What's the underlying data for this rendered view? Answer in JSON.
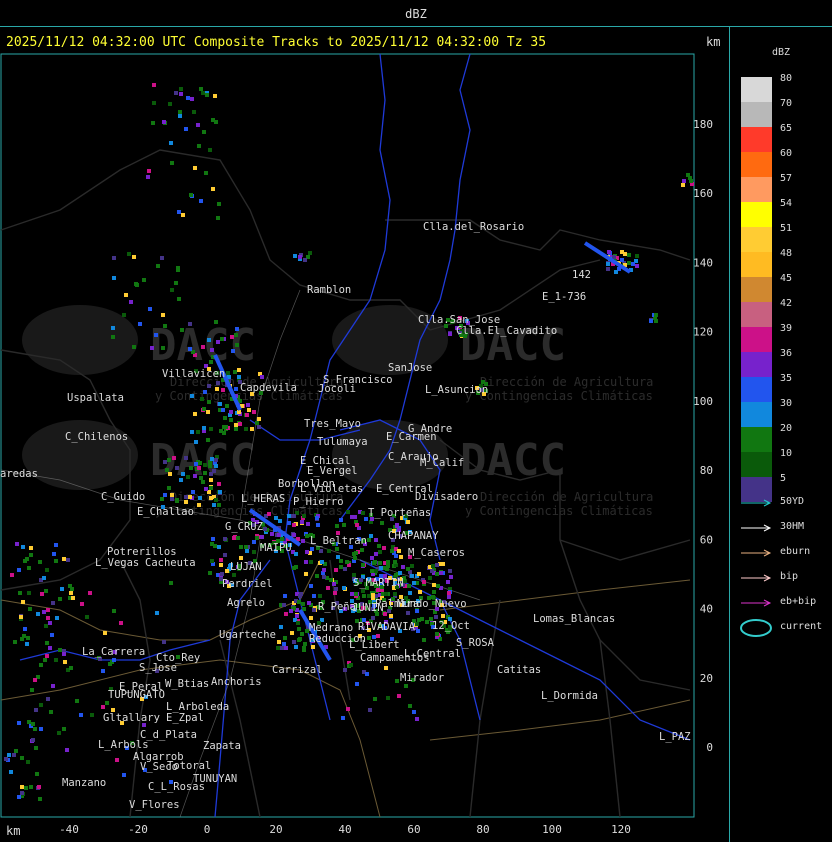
{
  "header": {
    "product": "dBZ"
  },
  "title": "2025/11/12 04:32:00 UTC Composite Tracks to 2025/11/12 04:32:00 Tz 35",
  "km_label": "km",
  "axis": {
    "x_ticks": [
      "-40",
      "-20",
      "0",
      "20",
      "40",
      "60",
      "80",
      "100",
      "120"
    ],
    "y_ticks": [
      "180",
      "160",
      "140",
      "120",
      "100",
      "80",
      "60",
      "40",
      "20",
      "0"
    ]
  },
  "legend": {
    "title": "dBZ",
    "bins": [
      {
        "label": "80",
        "color": "#d8d8d8"
      },
      {
        "label": "70",
        "color": "#b8b8b8"
      },
      {
        "label": "65",
        "color": "#ff3a2a"
      },
      {
        "label": "60",
        "color": "#ff6a10"
      },
      {
        "label": "57",
        "color": "#ff9a60"
      },
      {
        "label": "54",
        "color": "#ffff00"
      },
      {
        "label": "51",
        "color": "#ffcc33"
      },
      {
        "label": "48",
        "color": "#ffbb22"
      },
      {
        "label": "45",
        "color": "#d08830"
      },
      {
        "label": "42",
        "color": "#c86080"
      },
      {
        "label": "39",
        "color": "#cc1188"
      },
      {
        "label": "36",
        "color": "#7722cc"
      },
      {
        "label": "35",
        "color": "#2255ee"
      },
      {
        "label": "30",
        "color": "#1188dd"
      },
      {
        "label": "20",
        "color": "#117711"
      },
      {
        "label": "10",
        "color": "#0a5a0a"
      },
      {
        "label": "5",
        "color": "#443388"
      }
    ],
    "tracks": [
      {
        "label": "50YD",
        "color": "#22cccc"
      },
      {
        "label": "30HM",
        "color": "#ffffff"
      },
      {
        "label": "eburn",
        "color": "#e8b080"
      },
      {
        "label": "bip",
        "color": "#ffcccc"
      },
      {
        "label": "eb+bip",
        "color": "#dd33cc"
      },
      {
        "label": "current",
        "color": "#33cccc"
      }
    ]
  },
  "watermarks": [
    {
      "name": "DACC",
      "line1": "Dirección de Agricultura",
      "line2": "y Contingencias Climáticas"
    }
  ],
  "places": [
    {
      "name": "Clla.del_Rosario"
    },
    {
      "name": "Ramblon"
    },
    {
      "name": "142"
    },
    {
      "name": "E_1-736"
    },
    {
      "name": "Clla.San_Jose"
    },
    {
      "name": "Clla.El_Cavadito"
    },
    {
      "name": "Villavicen"
    },
    {
      "name": "Capdevila"
    },
    {
      "name": "S_Francisco"
    },
    {
      "name": "SanJose"
    },
    {
      "name": "Jocoli"
    },
    {
      "name": "L_Asuncion"
    },
    {
      "name": "Uspallata"
    },
    {
      "name": "Tres_Mayo"
    },
    {
      "name": "Tulumaya"
    },
    {
      "name": "G_Andre"
    },
    {
      "name": "E_Carmen"
    },
    {
      "name": "C_Chilenos"
    },
    {
      "name": "E_Chical"
    },
    {
      "name": "C_Araujo"
    },
    {
      "name": "M_Calif"
    },
    {
      "name": "aredas"
    },
    {
      "name": "E_Vergel"
    },
    {
      "name": "Borbollon"
    },
    {
      "name": "L_Violetas"
    },
    {
      "name": "E_Central"
    },
    {
      "name": "Divisadero"
    },
    {
      "name": "C_Guido"
    },
    {
      "name": "L_HERAS"
    },
    {
      "name": "P_Hierro"
    },
    {
      "name": "E_Challao"
    },
    {
      "name": "T_Porteñas"
    },
    {
      "name": "G_CRUZ"
    },
    {
      "name": "CHAPANAY"
    },
    {
      "name": "L_Beltran"
    },
    {
      "name": "M_Caseros"
    },
    {
      "name": "Potrerillos"
    },
    {
      "name": "Cacheuta"
    },
    {
      "name": "L_Vegas"
    },
    {
      "name": "MAIPU"
    },
    {
      "name": "LUJAN"
    },
    {
      "name": "S_MARTIN"
    },
    {
      "name": "Perdriel"
    },
    {
      "name": "Agrelo"
    },
    {
      "name": "R_Peña"
    },
    {
      "name": "JUNIN"
    },
    {
      "name": "Palmira"
    },
    {
      "name": "Mundo_Nuevo"
    },
    {
      "name": "Reduccion"
    },
    {
      "name": "RIVADAVIA"
    },
    {
      "name": "Ugarteche"
    },
    {
      "name": "Medrano"
    },
    {
      "name": "12_Oct"
    },
    {
      "name": "S_ROSA"
    },
    {
      "name": "Lomas_Blancas"
    },
    {
      "name": "La_Carrera"
    },
    {
      "name": "Cto_Rey"
    },
    {
      "name": "S_Jose"
    },
    {
      "name": "L_Libert"
    },
    {
      "name": "L_Central"
    },
    {
      "name": "Campamentos"
    },
    {
      "name": "Carrizal"
    },
    {
      "name": "Catitas"
    },
    {
      "name": "Anchoris"
    },
    {
      "name": "W_Btias"
    },
    {
      "name": "E_Peral"
    },
    {
      "name": "TUPUNGATO"
    },
    {
      "name": "Mirador"
    },
    {
      "name": "L_Dormida"
    },
    {
      "name": "L_Arboleda"
    },
    {
      "name": "Gltallary"
    },
    {
      "name": "E_Zpal"
    },
    {
      "name": "C_d_Plata"
    },
    {
      "name": "L_Arbols"
    },
    {
      "name": "Zapata"
    },
    {
      "name": "Algarrob"
    },
    {
      "name": "V_Seco"
    },
    {
      "name": "Totoral"
    },
    {
      "name": "Manzano"
    },
    {
      "name": "C_L_Rosas"
    },
    {
      "name": "TUNUYAN"
    },
    {
      "name": "V_Flores"
    },
    {
      "name": "L_PAZ"
    }
  ]
}
